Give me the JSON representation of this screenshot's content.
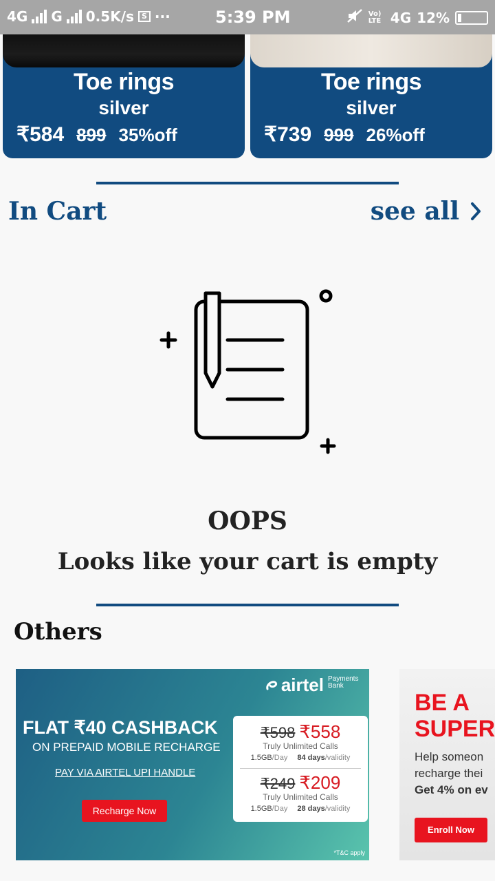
{
  "status_bar": {
    "network1": "4G",
    "network2": "G",
    "speed": "0.5K/s",
    "dots": "···",
    "time": "5:39 PM",
    "volte": "Vo) LTE",
    "network3": "4G",
    "battery": "12%"
  },
  "products": [
    {
      "title": "Toe rings",
      "subtitle": "silver",
      "price": "₹584",
      "mrp": "899",
      "discount": "35%off"
    },
    {
      "title": "Toe rings",
      "subtitle": "silver",
      "price": "₹739",
      "mrp": "999",
      "discount": "26%off"
    }
  ],
  "cart": {
    "title": "In Cart",
    "see_all": "see all",
    "empty_heading": "OOPS",
    "empty_message": "Looks like your cart is empty"
  },
  "others": {
    "title": "Others"
  },
  "banner_airtel": {
    "logo": "airtel",
    "logo_sub": "Payments Bank",
    "headline": "FLAT ₹40 CASHBACK",
    "subline": "ON PREPAID MOBILE RECHARGE",
    "upi": "PAY VIA AIRTEL UPI HANDLE",
    "button": "Recharge Now",
    "terms": "*T&C apply",
    "plans": [
      {
        "old": "₹598",
        "new": "₹558",
        "desc": "Truly Unlimited Calls",
        "data": "1.5GB",
        "data_unit": "/Day",
        "validity": "84 days",
        "validity_unit": "/validity"
      },
      {
        "old": "₹249",
        "new": "₹209",
        "desc": "Truly Unlimited Calls",
        "data": "1.5GB",
        "data_unit": "/Day",
        "validity": "28 days",
        "validity_unit": "/validity"
      }
    ]
  },
  "banner_super": {
    "headline_1": "BE A",
    "headline_2": "SUPER",
    "body_1": "Help someon",
    "body_2": "recharge thei",
    "body_3": "Get 4% on ev",
    "button": "Enroll Now"
  },
  "colors": {
    "brand_blue": "#114b80",
    "airtel_red": "#e8141f"
  }
}
